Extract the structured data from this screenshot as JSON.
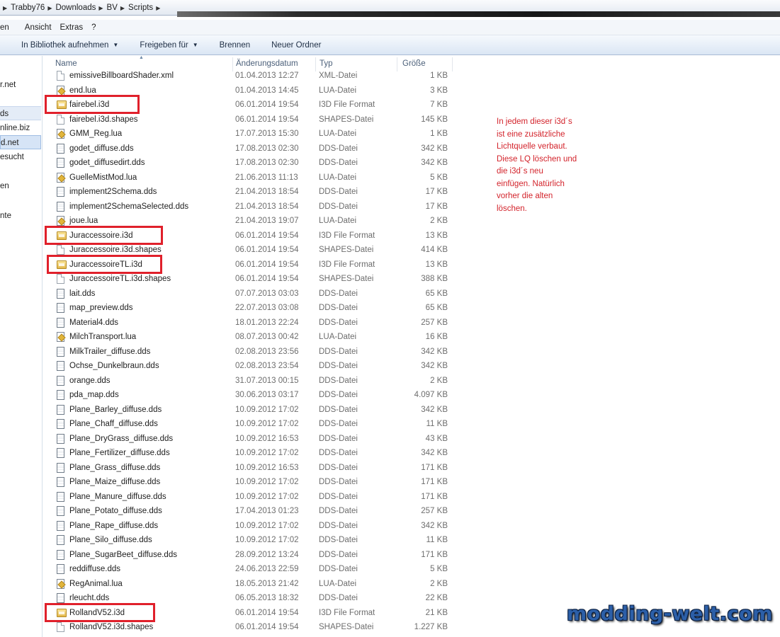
{
  "breadcrumb": {
    "items": [
      "Trabby76",
      "Downloads",
      "BV",
      "Scripts"
    ]
  },
  "menu": {
    "items": [
      "en",
      "Ansicht",
      "Extras",
      "?"
    ]
  },
  "toolbar": {
    "library_label": "In Bibliothek aufnehmen",
    "share_label": "Freigeben für",
    "burn_label": "Brennen",
    "new_folder_label": "Neuer Ordner"
  },
  "navigation": {
    "items": [
      "r.net",
      "ds",
      "nline.biz",
      "d.net",
      "esucht",
      "en",
      "nte"
    ]
  },
  "columns": {
    "name": "Name",
    "date": "Änderungsdatum",
    "type": "Typ",
    "size": "Größe"
  },
  "files": [
    {
      "name": "emissiveBillboardShader.xml",
      "date": "01.04.2013 12:27",
      "type": "XML-Datei",
      "size": "1 KB",
      "icon": "xml-file-icon"
    },
    {
      "name": "end.lua",
      "date": "01.04.2013 14:45",
      "type": "LUA-Datei",
      "size": "3 KB",
      "icon": "lua-file-icon"
    },
    {
      "name": "fairebel.i3d",
      "date": "06.01.2014 19:54",
      "type": "I3D File Format",
      "size": "7 KB",
      "icon": "i3d-file-icon",
      "highlight": true
    },
    {
      "name": "fairebel.i3d.shapes",
      "date": "06.01.2014 19:54",
      "type": "SHAPES-Datei",
      "size": "145 KB",
      "icon": "generic-file-icon"
    },
    {
      "name": "GMM_Reg.lua",
      "date": "17.07.2013 15:30",
      "type": "LUA-Datei",
      "size": "1 KB",
      "icon": "lua-file-icon"
    },
    {
      "name": "godet_diffuse.dds",
      "date": "17.08.2013 02:30",
      "type": "DDS-Datei",
      "size": "342 KB",
      "icon": "dds-file-icon"
    },
    {
      "name": "godet_diffusedirt.dds",
      "date": "17.08.2013 02:30",
      "type": "DDS-Datei",
      "size": "342 KB",
      "icon": "dds-file-icon"
    },
    {
      "name": "GuelleMistMod.lua",
      "date": "21.06.2013 11:13",
      "type": "LUA-Datei",
      "size": "5 KB",
      "icon": "lua-file-icon"
    },
    {
      "name": "implement2Schema.dds",
      "date": "21.04.2013 18:54",
      "type": "DDS-Datei",
      "size": "17 KB",
      "icon": "dds-file-icon"
    },
    {
      "name": "implement2SchemaSelected.dds",
      "date": "21.04.2013 18:54",
      "type": "DDS-Datei",
      "size": "17 KB",
      "icon": "dds-file-icon"
    },
    {
      "name": "joue.lua",
      "date": "21.04.2013 19:07",
      "type": "LUA-Datei",
      "size": "2 KB",
      "icon": "lua-file-icon"
    },
    {
      "name": "Juraccessoire.i3d",
      "date": "06.01.2014 19:54",
      "type": "I3D File Format",
      "size": "13 KB",
      "icon": "i3d-file-icon",
      "highlight": true
    },
    {
      "name": "Juraccessoire.i3d.shapes",
      "date": "06.01.2014 19:54",
      "type": "SHAPES-Datei",
      "size": "414 KB",
      "icon": "generic-file-icon"
    },
    {
      "name": "JuraccessoireTL.i3d",
      "date": "06.01.2014 19:54",
      "type": "I3D File Format",
      "size": "13 KB",
      "icon": "i3d-file-icon",
      "highlight": true
    },
    {
      "name": "JuraccessoireTL.i3d.shapes",
      "date": "06.01.2014 19:54",
      "type": "SHAPES-Datei",
      "size": "388 KB",
      "icon": "generic-file-icon"
    },
    {
      "name": "lait.dds",
      "date": "07.07.2013 03:03",
      "type": "DDS-Datei",
      "size": "65 KB",
      "icon": "dds-file-icon"
    },
    {
      "name": "map_preview.dds",
      "date": "22.07.2013 03:08",
      "type": "DDS-Datei",
      "size": "65 KB",
      "icon": "dds-file-icon"
    },
    {
      "name": "Material4.dds",
      "date": "18.01.2013 22:24",
      "type": "DDS-Datei",
      "size": "257 KB",
      "icon": "dds-file-icon"
    },
    {
      "name": "MilchTransport.lua",
      "date": "08.07.2013 00:42",
      "type": "LUA-Datei",
      "size": "16 KB",
      "icon": "lua-file-icon"
    },
    {
      "name": "MilkTrailer_diffuse.dds",
      "date": "02.08.2013 23:56",
      "type": "DDS-Datei",
      "size": "342 KB",
      "icon": "dds-file-icon"
    },
    {
      "name": "Ochse_Dunkelbraun.dds",
      "date": "02.08.2013 23:54",
      "type": "DDS-Datei",
      "size": "342 KB",
      "icon": "dds-file-icon"
    },
    {
      "name": "orange.dds",
      "date": "31.07.2013 00:15",
      "type": "DDS-Datei",
      "size": "2 KB",
      "icon": "dds-file-icon"
    },
    {
      "name": "pda_map.dds",
      "date": "30.06.2013 03:17",
      "type": "DDS-Datei",
      "size": "4.097 KB",
      "icon": "dds-file-icon"
    },
    {
      "name": "Plane_Barley_diffuse.dds",
      "date": "10.09.2012 17:02",
      "type": "DDS-Datei",
      "size": "342 KB",
      "icon": "dds-file-icon"
    },
    {
      "name": "Plane_Chaff_diffuse.dds",
      "date": "10.09.2012 17:02",
      "type": "DDS-Datei",
      "size": "11 KB",
      "icon": "dds-file-icon"
    },
    {
      "name": "Plane_DryGrass_diffuse.dds",
      "date": "10.09.2012 16:53",
      "type": "DDS-Datei",
      "size": "43 KB",
      "icon": "dds-file-icon"
    },
    {
      "name": "Plane_Fertilizer_diffuse.dds",
      "date": "10.09.2012 17:02",
      "type": "DDS-Datei",
      "size": "342 KB",
      "icon": "dds-file-icon"
    },
    {
      "name": "Plane_Grass_diffuse.dds",
      "date": "10.09.2012 16:53",
      "type": "DDS-Datei",
      "size": "171 KB",
      "icon": "dds-file-icon"
    },
    {
      "name": "Plane_Maize_diffuse.dds",
      "date": "10.09.2012 17:02",
      "type": "DDS-Datei",
      "size": "171 KB",
      "icon": "dds-file-icon"
    },
    {
      "name": "Plane_Manure_diffuse.dds",
      "date": "10.09.2012 17:02",
      "type": "DDS-Datei",
      "size": "171 KB",
      "icon": "dds-file-icon"
    },
    {
      "name": "Plane_Potato_diffuse.dds",
      "date": "17.04.2013 01:23",
      "type": "DDS-Datei",
      "size": "257 KB",
      "icon": "dds-file-icon"
    },
    {
      "name": "Plane_Rape_diffuse.dds",
      "date": "10.09.2012 17:02",
      "type": "DDS-Datei",
      "size": "342 KB",
      "icon": "dds-file-icon"
    },
    {
      "name": "Plane_Silo_diffuse.dds",
      "date": "10.09.2012 17:02",
      "type": "DDS-Datei",
      "size": "11 KB",
      "icon": "dds-file-icon"
    },
    {
      "name": "Plane_SugarBeet_diffuse.dds",
      "date": "28.09.2012 13:24",
      "type": "DDS-Datei",
      "size": "171 KB",
      "icon": "dds-file-icon"
    },
    {
      "name": "reddiffuse.dds",
      "date": "24.06.2013 22:59",
      "type": "DDS-Datei",
      "size": "5 KB",
      "icon": "dds-file-icon"
    },
    {
      "name": "RegAnimal.lua",
      "date": "18.05.2013 21:42",
      "type": "LUA-Datei",
      "size": "2 KB",
      "icon": "lua-file-icon"
    },
    {
      "name": "rleucht.dds",
      "date": "06.05.2013 18:32",
      "type": "DDS-Datei",
      "size": "22 KB",
      "icon": "dds-file-icon"
    },
    {
      "name": "RollandV52.i3d",
      "date": "06.01.2014 19:54",
      "type": "I3D File Format",
      "size": "21 KB",
      "icon": "i3d-file-icon",
      "highlight": true
    },
    {
      "name": "RollandV52.i3d.shapes",
      "date": "06.01.2014 19:54",
      "type": "SHAPES-Datei",
      "size": "1.227 KB",
      "icon": "generic-file-icon"
    }
  ],
  "annotation": {
    "lines": [
      "In jedem dieser i3d´s",
      "ist eine zusätzliche",
      "Lichtquelle verbaut.",
      "Diese LQ löschen und",
      "die i3d´s neu",
      "einfügen. Natürlich",
      "vorher die alten",
      "löschen."
    ],
    "color": "#d3232b"
  },
  "watermark": {
    "text": "modding-welt.com"
  },
  "colors": {
    "highlight_box": "#e0202b",
    "header_text": "#4c607a",
    "meta_text": "#6d6d6d"
  }
}
